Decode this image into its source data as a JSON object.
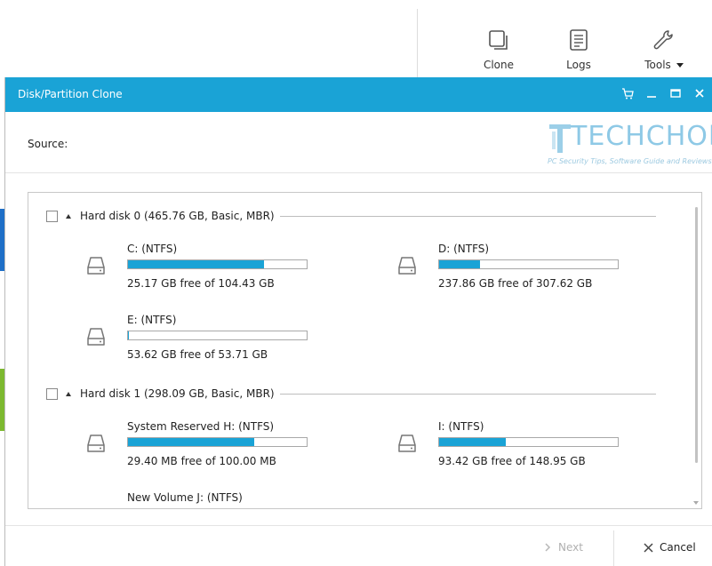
{
  "toolbar": {
    "clone_label": "Clone",
    "logs_label": "Logs",
    "tools_label": "Tools"
  },
  "dialog": {
    "title": "Disk/Partition Clone",
    "source_label": "Source:",
    "next_label": "Next",
    "cancel_label": "Cancel",
    "accent_color": "#1aa3d6"
  },
  "watermark": {
    "brand": "TECHCHORE",
    "tagline": "PC Security Tips, Software Guide and Reviews"
  },
  "disks": [
    {
      "label": "Hard disk 0 (465.76 GB, Basic, MBR)",
      "partitions": [
        {
          "name": "C: (NTFS)",
          "free_text": "25.17 GB free of 104.43 GB",
          "used_fraction": 0.759
        },
        {
          "name": "D: (NTFS)",
          "free_text": "237.86 GB free of 307.62 GB",
          "used_fraction": 0.227
        },
        {
          "name": "E: (NTFS)",
          "free_text": "53.62 GB free of 53.71 GB",
          "used_fraction": 0.002
        }
      ]
    },
    {
      "label": "Hard disk 1 (298.09 GB, Basic, MBR)",
      "partitions": [
        {
          "name": "System Reserved H: (NTFS)",
          "free_text": "29.40 MB free of 100.00 MB",
          "used_fraction": 0.706
        },
        {
          "name": "I: (NTFS)",
          "free_text": "93.42 GB free of 148.95 GB",
          "used_fraction": 0.373
        },
        {
          "name": "New Volume J: (NTFS)",
          "free_text": "",
          "used_fraction": null
        }
      ]
    }
  ],
  "icons": {
    "clone": "clone-icon",
    "logs": "logs-icon",
    "tools": "wrench-icon",
    "cart": "cart-icon",
    "minimize": "minimize-icon",
    "maximize": "maximize-icon",
    "close": "close-icon",
    "drive": "hard-drive-icon",
    "next": "chevron-right-icon",
    "cancel": "x-icon"
  }
}
